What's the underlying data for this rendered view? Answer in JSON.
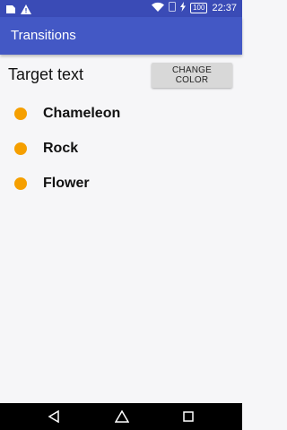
{
  "status_bar": {
    "left_icons": [
      "image-icon",
      "warning-icon"
    ],
    "right_icons": [
      "wifi-icon",
      "sim-card-icon",
      "charging-icon"
    ],
    "battery_level": "100",
    "time": "22:37"
  },
  "app_bar": {
    "title": "Transitions"
  },
  "main": {
    "target_text": "Target text",
    "change_color_label": "CHANGE COLOR",
    "items": [
      {
        "label": "Chameleon",
        "dot_color": "#f59f00"
      },
      {
        "label": "Rock",
        "dot_color": "#f59f00"
      },
      {
        "label": "Flower",
        "dot_color": "#f59f00"
      }
    ]
  },
  "nav_bar": {
    "buttons": [
      "back-icon",
      "home-icon",
      "recents-icon"
    ]
  },
  "colors": {
    "status_bar": "#3a4bb6",
    "app_bar": "#4358c5",
    "accent": "#f59f00"
  }
}
